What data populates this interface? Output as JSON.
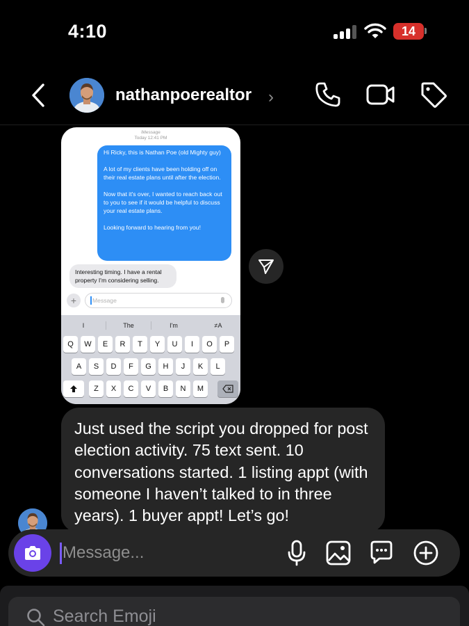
{
  "status_bar": {
    "time": "4:10",
    "battery": "14",
    "icons": [
      "cellular-signal-icon",
      "wifi-icon",
      "battery-icon"
    ],
    "battery_color": "#d7302b"
  },
  "header": {
    "username": "nathanpoerealtor",
    "chevron": "›",
    "icons": [
      "back-icon",
      "phone-call-icon",
      "video-call-icon",
      "tag-icon"
    ]
  },
  "shared_image": {
    "app_label": "iMessage",
    "timestamp": "Today 12:41 PM",
    "sent_message": [
      "Hi Ricky, this is Nathan Poe (old Mighty guy)",
      "A lot of my clients have been holding off on their real estate plans until after the election.",
      "Now that it's over, I wanted to reach back out to you to see if it would be helpful to discuss your real estate plans.",
      "Looking forward to hearing from you!"
    ],
    "received_message": "Interesting timing. I have a rental property I'm considering selling.",
    "input_placeholder": "Message",
    "plus": "+",
    "suggestions": [
      "I",
      "The",
      "I'm",
      "≠A"
    ],
    "keyboard_rows": [
      [
        "Q",
        "W",
        "E",
        "R",
        "T",
        "Y",
        "U",
        "I",
        "O",
        "P"
      ],
      [
        "A",
        "S",
        "D",
        "F",
        "G",
        "H",
        "J",
        "K",
        "L"
      ],
      [
        "Z",
        "X",
        "C",
        "V",
        "B",
        "N",
        "M"
      ]
    ],
    "sent_bubble_color": "#2d8ef5"
  },
  "message": {
    "text": "Just used the script you dropped for post election activity. 75 text sent. 10 conversations started. 1 listing appt (with someone I haven’t talked to in three years). 1 buyer appt! Let’s go!"
  },
  "composer": {
    "placeholder": "Message...",
    "camera_color": "#6a42e8",
    "icons": [
      "camera-icon",
      "microphone-icon",
      "image-icon",
      "sticker-icon",
      "plus-circle-icon"
    ]
  },
  "emoji_search": {
    "placeholder": "Search Emoji"
  }
}
